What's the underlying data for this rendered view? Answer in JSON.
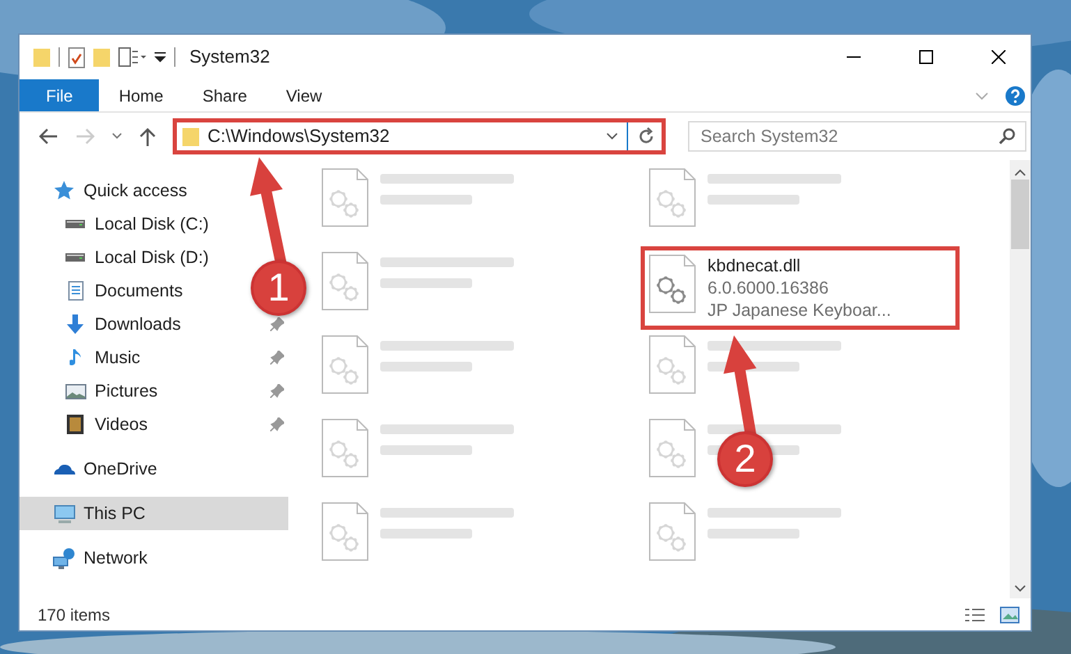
{
  "window": {
    "title": "System32"
  },
  "ribbon_tabs": [
    {
      "label": "File",
      "selected": true
    },
    {
      "label": "Home",
      "selected": false
    },
    {
      "label": "Share",
      "selected": false
    },
    {
      "label": "View",
      "selected": false
    }
  ],
  "address_bar": {
    "value": "C:\\Windows\\System32",
    "highlighted": true
  },
  "search": {
    "placeholder": "Search System32"
  },
  "sidebar": {
    "items": [
      {
        "label": "Quick access",
        "kind": "star",
        "selected": false,
        "children": [
          {
            "label": "Local Disk (C:)",
            "kind": "drive",
            "selected": false
          },
          {
            "label": "Local Disk (D:)",
            "kind": "drive",
            "selected": false
          },
          {
            "label": "Documents",
            "kind": "documents",
            "selected": false
          },
          {
            "label": "Downloads",
            "kind": "downloads",
            "pinned": true,
            "selected": false
          },
          {
            "label": "Music",
            "kind": "music",
            "pinned": true,
            "selected": false
          },
          {
            "label": "Pictures",
            "kind": "pictures",
            "pinned": true,
            "selected": false
          },
          {
            "label": "Videos",
            "kind": "videos",
            "pinned": true,
            "selected": false
          }
        ]
      },
      {
        "label": "OneDrive",
        "kind": "cloud",
        "selected": false
      },
      {
        "label": "This PC",
        "kind": "pc",
        "selected": true
      },
      {
        "label": "Network",
        "kind": "network",
        "selected": false
      }
    ]
  },
  "files": [
    {
      "kind": "blurred",
      "highlighted": false
    },
    {
      "kind": "blurred",
      "highlighted": false
    },
    {
      "kind": "blurred",
      "highlighted": false
    },
    {
      "kind": "file",
      "name": "kbdnecat.dll",
      "details": [
        "6.0.6000.16386",
        "JP Japanese Keyboar..."
      ],
      "highlighted": true
    },
    {
      "kind": "blurred",
      "highlighted": false
    },
    {
      "kind": "blurred",
      "highlighted": false
    },
    {
      "kind": "blurred",
      "highlighted": false
    },
    {
      "kind": "blurred",
      "highlighted": false
    },
    {
      "kind": "blurred",
      "highlighted": false
    },
    {
      "kind": "blurred",
      "highlighted": false
    }
  ],
  "status_bar": {
    "text": "170 items"
  },
  "annotations": [
    {
      "label": "1"
    },
    {
      "label": "2"
    }
  ]
}
